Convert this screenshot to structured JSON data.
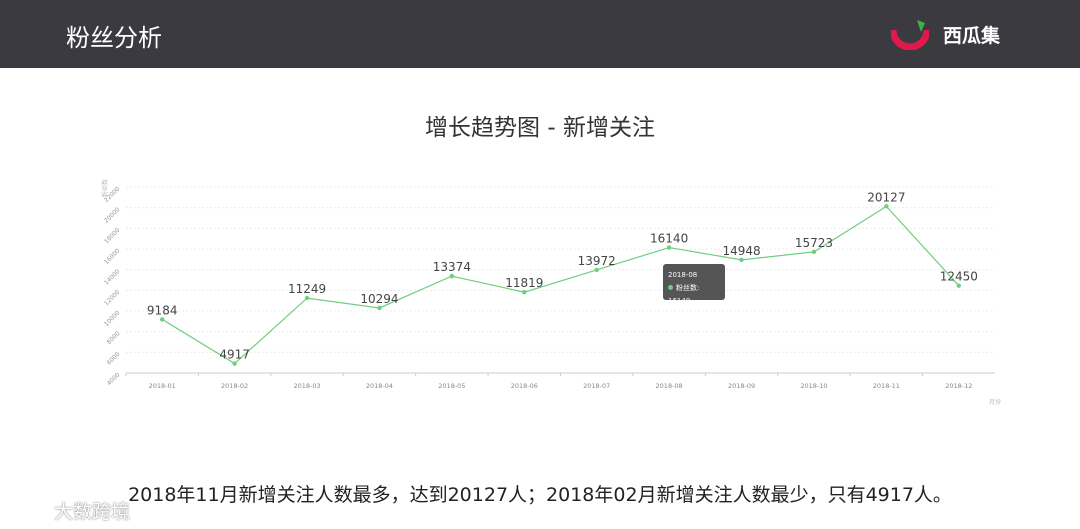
{
  "header": {
    "title": "粉丝分析",
    "brand_name": "西瓜集"
  },
  "chart_title": "增长趋势图 - 新增关注",
  "chart_data": {
    "type": "line",
    "title": "增长趋势图 - 新增关注",
    "categories": [
      "2018-01",
      "2018-02",
      "2018-03",
      "2018-04",
      "2018-05",
      "2018-06",
      "2018-07",
      "2018-08",
      "2018-09",
      "2018-10",
      "2018-11",
      "2018-12"
    ],
    "series": [
      {
        "name": "粉丝数",
        "values": [
          9184,
          4917,
          11249,
          10294,
          13374,
          11819,
          13972,
          16140,
          14948,
          15723,
          20127,
          12450
        ],
        "color": "#6fce7f"
      }
    ],
    "ylabel": "粉丝数",
    "xlabel": "月份",
    "ylim": [
      4000,
      22000
    ],
    "yticks": [
      4000,
      6000,
      8000,
      10000,
      12000,
      14000,
      16000,
      18000,
      20000,
      22000
    ],
    "grid": true
  },
  "tooltip": {
    "title": "2018-08",
    "label": "粉丝数: 16140"
  },
  "summary": "2018年11月新增关注人数最多，达到20127人；2018年02月新增关注人数最少，只有4917人。",
  "watermark": "大数跨境",
  "colors": {
    "header_bg": "#3a3a40",
    "line": "#6fce7f",
    "brand_red": "#e0194a",
    "brand_green": "#3cb34a"
  }
}
